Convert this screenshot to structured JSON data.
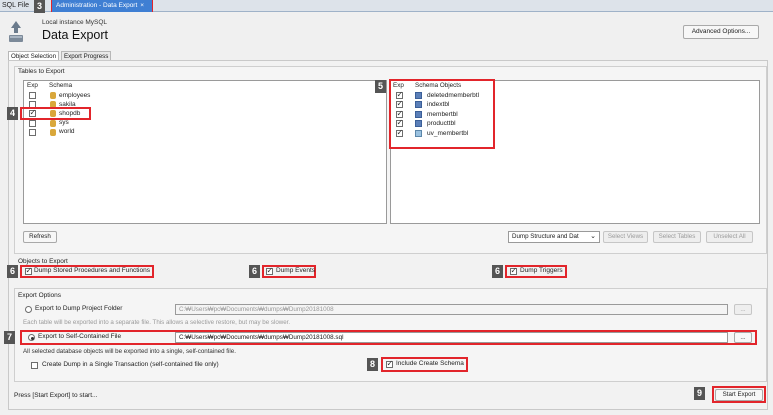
{
  "tabs": {
    "sql_file": "SQL File",
    "admin": "Administration - Data Export",
    "close": "×"
  },
  "header": {
    "subtitle": "Local instance MySQL",
    "title": "Data Export",
    "advanced_button": "Advanced Options..."
  },
  "subtabs": [
    "Object Selection",
    "Export Progress"
  ],
  "tables_group": {
    "title": "Tables to Export",
    "schema_list": {
      "col_exp": "Exp",
      "col_schema": "Schema",
      "rows": [
        {
          "name": "employees",
          "checked": false
        },
        {
          "name": "sakila",
          "checked": false
        },
        {
          "name": "shopdb",
          "checked": true
        },
        {
          "name": "sys",
          "checked": false
        },
        {
          "name": "world",
          "checked": false
        }
      ]
    },
    "objects_list": {
      "col_exp": "Exp",
      "col_objects": "Schema Objects",
      "rows": [
        {
          "name": "deletedmemberbtl",
          "checked": true,
          "kind": "table-icon"
        },
        {
          "name": "indextbl",
          "checked": true,
          "kind": "table-icon"
        },
        {
          "name": "membertbl",
          "checked": true,
          "kind": "table-icon"
        },
        {
          "name": "producttbl",
          "checked": true,
          "kind": "table-icon"
        },
        {
          "name": "uv_membertbl",
          "checked": true,
          "kind": "view-icon"
        }
      ]
    },
    "refresh_button": "Refresh",
    "dump_select": "Dump Structure and Dat",
    "select_views_button": "Select Views",
    "select_tables_button": "Select Tables",
    "unselect_all_button": "Unselect All"
  },
  "objects_group": {
    "title": "Objects to Export",
    "dump_routines": "Dump Stored Procedures and Functions",
    "dump_events": "Dump Events",
    "dump_triggers": "Dump Triggers"
  },
  "options_group": {
    "title": "Export Options",
    "project_folder_label": "Export to Dump Project Folder",
    "project_folder_path": "C:₩Users₩pc₩Documents₩dumps₩Dump20181008",
    "project_folder_hint": "Each table will be exported into a separate file. This allows a selective restore, but may be slower.",
    "self_contained_label": "Export to Self-Contained File",
    "self_contained_path": "C:₩Users₩pc₩Documents₩dumps₩Dump20181008.sql",
    "self_contained_hint": "All selected database objects will be exported into a single, self-contained file.",
    "single_transaction": "Create Dump in a Single Transaction (self-contained file only)",
    "include_schema": "Include Create Schema",
    "browse": "..."
  },
  "footer": {
    "status": "Press [Start Export] to start...",
    "start_button": "Start Export"
  },
  "annotations": [
    "3",
    "4",
    "5",
    "6",
    "6",
    "6",
    "7",
    "8",
    "9"
  ]
}
